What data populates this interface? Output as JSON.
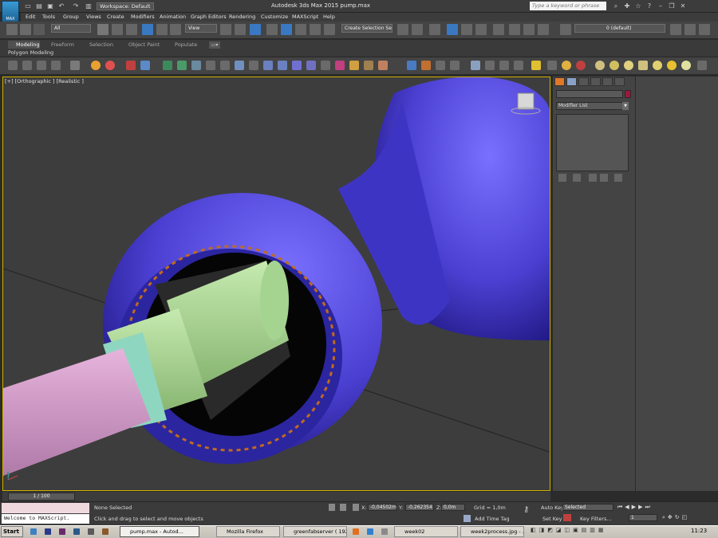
{
  "titlebar": {
    "app_logo_text": "MAX",
    "workspace": "Workspace: Default",
    "title": "Autodesk 3ds Max 2015      pump.max",
    "search_placeholder": "Type a keyword or phrase"
  },
  "menu": [
    "Edit",
    "Tools",
    "Group",
    "Views",
    "Create",
    "Modifiers",
    "Animation",
    "Graph Editors",
    "Rendering",
    "Customize",
    "MAXScript",
    "Help"
  ],
  "toolbar": {
    "selection_filter": "All",
    "reference_coord": "View",
    "named_selection": "Create Selection Se",
    "layer": "0 (default)"
  },
  "ribbon": {
    "tabs": [
      "Modeling",
      "Freeform",
      "Selection",
      "Object Paint",
      "Populate"
    ],
    "sub_label": "Polygon Modeling"
  },
  "viewport": {
    "label": "[+] [Orthographic ] [Realistic ]"
  },
  "command_panel": {
    "modifier_list": "Modifier List"
  },
  "timeline": {
    "frame": "1 / 100"
  },
  "status": {
    "maxscript_top": "Welcome to MAXScript.",
    "selection": "None Selected",
    "prompt": "Click and drag to select and move objects",
    "x_label": "X:",
    "x_value": "-0,04502m",
    "y_label": "Y:",
    "y_value": "-0,262354",
    "z_label": "Z:",
    "z_value": "0,0m",
    "grid": "Grid = 1,0m",
    "add_time_tag": "Add Time Tag",
    "auto_key": "Auto Key",
    "set_key": "Set Key",
    "selected": "Selected",
    "key_filters": "Key Filters...",
    "frame_field": "1"
  },
  "taskbar": {
    "start": "Start",
    "tasks": [
      "pump.max - Autod...",
      "Mozilla Firefox",
      "greenfabserver ( 192...",
      "week02",
      "week2process.jpg - ..."
    ],
    "clock": "11:23"
  },
  "colors": {
    "pump_body": "#4a3fd0",
    "shaft_pink": "#d9a0d0",
    "collar_green": "#a8d890",
    "ring_teal": "#8ed6c0",
    "spring_orange": "#d07a2a",
    "viewport_border": "#d0b000"
  }
}
